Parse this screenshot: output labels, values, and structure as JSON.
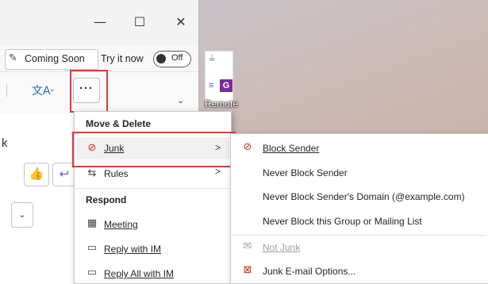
{
  "window": {
    "minimize_glyph": "—",
    "maximize_glyph": "☐",
    "close_glyph": "✕"
  },
  "toolbar": {
    "coming_soon_label": "Coming Soon",
    "try_it_now_label": "Try it now",
    "toggle_state": "Off",
    "more_button_label": "···"
  },
  "desktop": {
    "remote_label": "Remote"
  },
  "context_menu": {
    "section_move_delete": "Move & Delete",
    "junk_label": "Junk",
    "rules_label": "Rules",
    "section_respond": "Respond",
    "meeting_label": "Meeting",
    "reply_im_label": "Reply with IM",
    "reply_all_im_label": "Reply All with IM",
    "submenu_arrow": ">"
  },
  "junk_submenu": {
    "block_sender": "Block Sender",
    "never_block_sender": "Never Block Sender",
    "never_block_domain": "Never Block Sender's Domain (@example.com)",
    "never_block_group": "Never Block this Group or Mailing List",
    "not_junk": "Not Junk",
    "junk_options": "Junk E-mail Options..."
  },
  "colors": {
    "highlight": "#e0393e",
    "block_icon": "#c42b1c"
  }
}
